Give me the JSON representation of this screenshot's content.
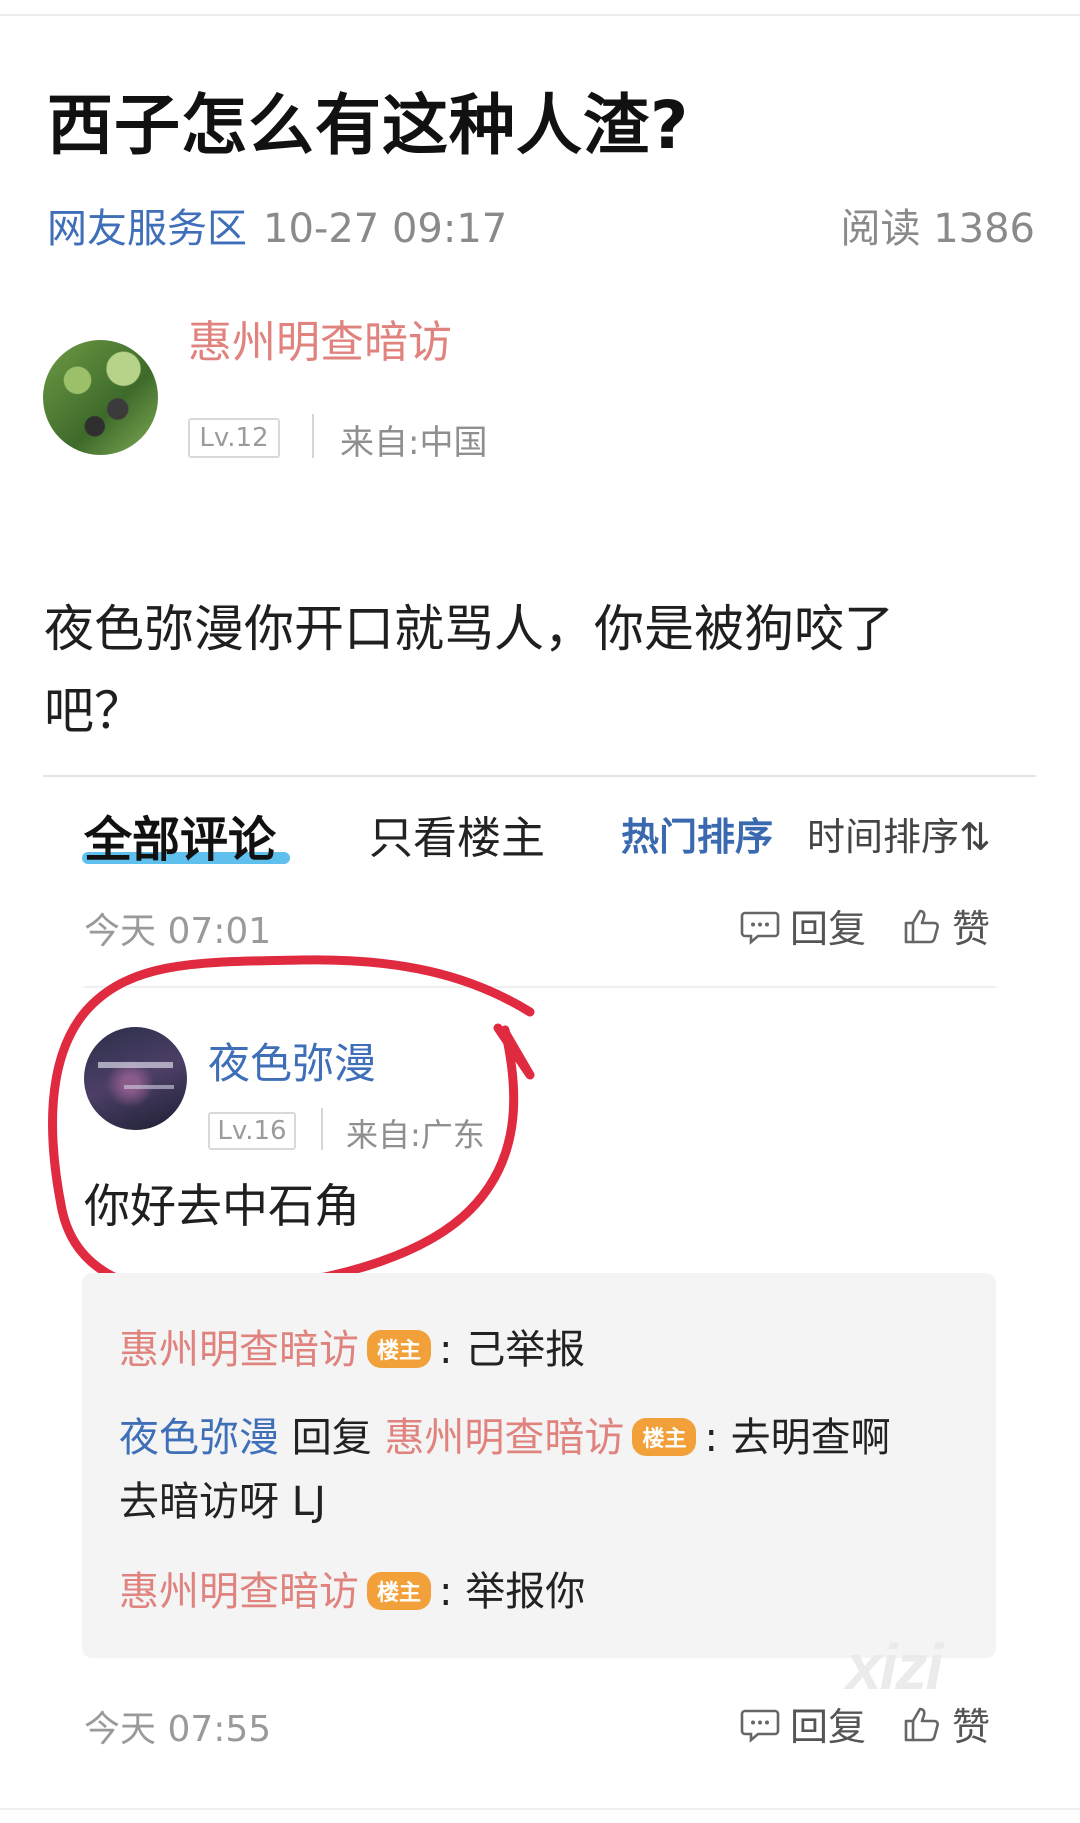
{
  "post": {
    "title": "西子怎么有这种人渣?",
    "forum": "网友服务区",
    "date": "10-27 09:17",
    "reads": "阅读 1386",
    "author": {
      "name": "惠州明查暗访",
      "level": "Lv.12",
      "from": "来自:中国"
    },
    "body": "夜色弥漫你开口就骂人，你是被狗咬了吧？"
  },
  "comments_bar": {
    "tab_all": "全部评论",
    "tab_op_only": "只看楼主",
    "sort_hot": "热门排序",
    "sort_time": "时间排序⇅"
  },
  "comment1": {
    "time": "今天 07:01",
    "reply_label": "回复",
    "like_label": "赞",
    "user": {
      "name": "夜色弥漫",
      "level": "Lv.16",
      "from": "来自:广东"
    },
    "text": "你好去中石角",
    "replies": {
      "r1": {
        "user": "惠州明查暗访",
        "badge": "楼主",
        "text": ": 己举报"
      },
      "r2": {
        "user": "夜色弥漫",
        "verb": "回复",
        "target": "惠州明查暗访",
        "badge": "楼主",
        "text": ": 去明查啊",
        "text_cont": "去暗访呀 LJ"
      },
      "r3": {
        "user": "惠州明查暗访",
        "badge": "楼主",
        "text": ": 举报你"
      }
    }
  },
  "comment2": {
    "time": "今天 07:55",
    "reply_label": "回复",
    "like_label": "赞"
  },
  "watermark": "xizi",
  "colors": {
    "link_blue": "#3f6fb8",
    "author_red": "#e0837e",
    "op_badge": "#f2a13a",
    "annotation_red": "#e02a3f",
    "tab_underline": "#5fc0ee"
  }
}
